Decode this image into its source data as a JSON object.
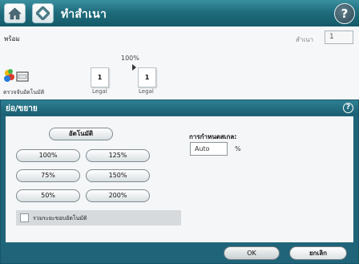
{
  "header": {
    "title": "ทำสำเนา",
    "home_icon": "home-icon",
    "copy_icon": "copy-icon",
    "help_icon": "help-icon",
    "help_glyph": "?"
  },
  "status": {
    "text": "พร้อม"
  },
  "copies": {
    "label": "สำเนา",
    "value": "1"
  },
  "preview": {
    "zoom": "100%",
    "original": {
      "count": "1",
      "size": "Legal"
    },
    "output": {
      "count": "1",
      "size": "Legal"
    },
    "arrow_icon": "arrow-right-icon"
  },
  "settings_shortcut": {
    "label": "ตรวจจับอัตโนมัติ",
    "icon": "color-printer-icon"
  },
  "dialog": {
    "title": "ย่อ/ขยาย",
    "help_glyph": "?",
    "auto_label": "อัตโนมัติ",
    "presets": [
      "100%",
      "125%",
      "75%",
      "150%",
      "50%",
      "200%"
    ],
    "custom": {
      "label": "การกำหนดสเกล:",
      "value": "Auto",
      "unit": "%"
    },
    "checkbox": {
      "label": "รวมระยะขอบอัตโนมัติ",
      "checked": false
    },
    "ok_label": "OK",
    "cancel_label": "ยกเลิก"
  },
  "colors": {
    "accent": "#1f6479",
    "titlebar": "#1f6d7e",
    "body": "#f4f6f7"
  }
}
